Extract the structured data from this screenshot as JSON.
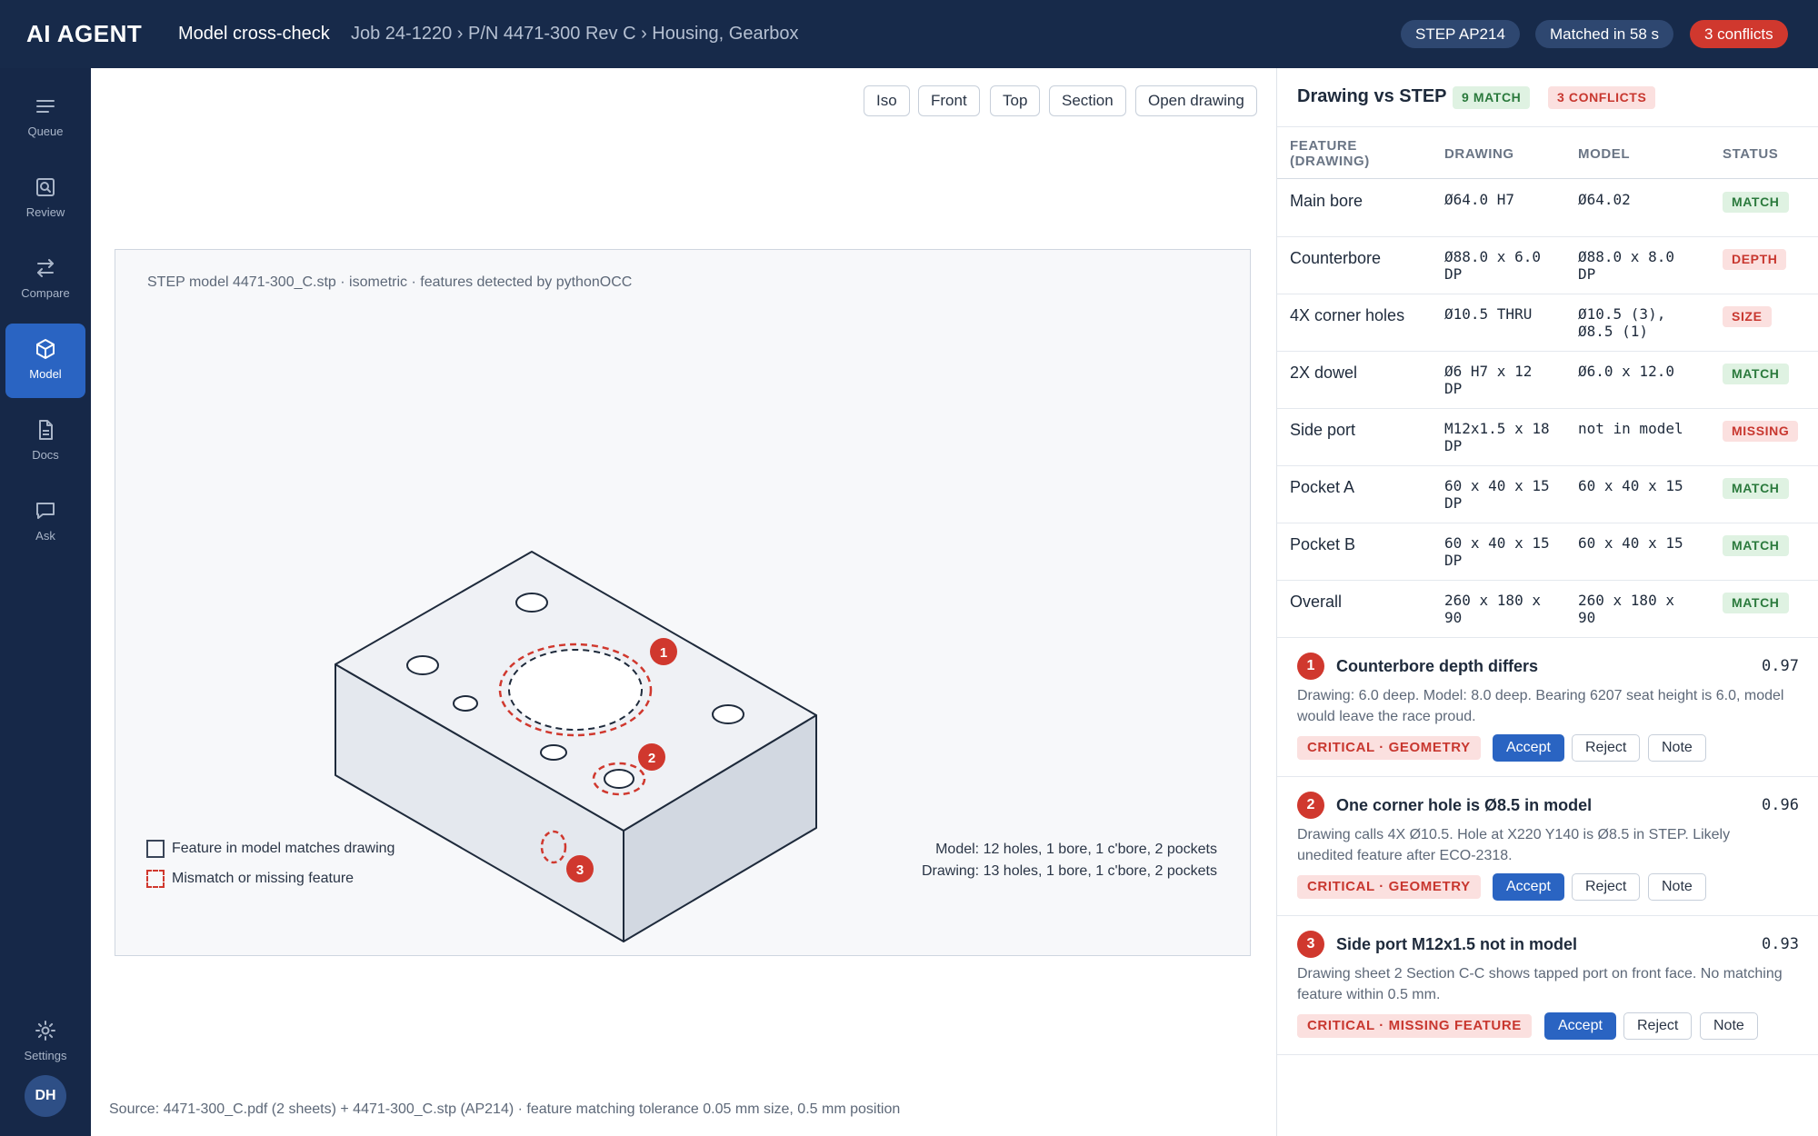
{
  "app": {
    "brand": "AI AGENT",
    "screen_title": "Model cross-check",
    "breadcrumb": "Job 24-1220 › P/N 4471-300 Rev C › Housing, Gearbox",
    "pills": {
      "format": "STEP AP214",
      "matched": "Matched in 58 s",
      "conflicts": "3 conflicts"
    }
  },
  "nav": {
    "items": [
      {
        "label": "Queue",
        "icon": "list-icon"
      },
      {
        "label": "Review",
        "icon": "search-doc-icon"
      },
      {
        "label": "Compare",
        "icon": "compare-arrows-icon"
      },
      {
        "label": "Model",
        "icon": "cube-icon",
        "active": true
      },
      {
        "label": "Docs",
        "icon": "document-icon"
      },
      {
        "label": "Ask",
        "icon": "chat-icon"
      }
    ],
    "settings": "Settings",
    "avatar": "DH"
  },
  "viewer": {
    "buttons": [
      "Iso",
      "Front",
      "Top",
      "Section",
      "Open drawing"
    ],
    "caption": "STEP model 4471-300_C.stp · isometric · features detected by pythonOCC",
    "legend": {
      "match": "Feature in model matches drawing",
      "mismatch": "Mismatch or missing feature"
    },
    "counts": {
      "model": "Model: 12 holes, 1 bore, 1 c'bore, 2 pockets",
      "drawing": "Drawing: 13 holes, 1 bore, 1 c'bore, 2 pockets"
    },
    "markers": [
      "1",
      "2",
      "3"
    ],
    "source": "Source: 4471-300_C.pdf (2 sheets) + 4471-300_C.stp (AP214) · feature matching tolerance 0.05 mm size, 0.5 mm position"
  },
  "panel": {
    "title": "Drawing vs STEP",
    "match_badge": "9 MATCH",
    "conflict_badge": "3 CONFLICTS",
    "columns": {
      "feature": "FEATURE (DRAWING)",
      "drawing": "DRAWING",
      "model": "MODEL",
      "status": "STATUS"
    },
    "rows": [
      {
        "feature": "Main bore",
        "drawing": "Ø64.0 H7",
        "model": "Ø64.02",
        "status": "MATCH",
        "ok": true
      },
      {
        "feature": "Counterbore",
        "drawing": "Ø88.0 x 6.0 DP",
        "model": "Ø88.0 x 8.0 DP",
        "status": "DEPTH",
        "ok": false
      },
      {
        "feature": "4X corner holes",
        "drawing": "Ø10.5 THRU",
        "model": "Ø10.5 (3), Ø8.5 (1)",
        "status": "SIZE",
        "ok": false
      },
      {
        "feature": "2X dowel",
        "drawing": "Ø6 H7 x 12 DP",
        "model": "Ø6.0 x 12.0",
        "status": "MATCH",
        "ok": true
      },
      {
        "feature": "Side port",
        "drawing": "M12x1.5 x 18 DP",
        "model": "not in model",
        "status": "MISSING",
        "ok": false
      },
      {
        "feature": "Pocket A",
        "drawing": "60 x 40 x 15 DP",
        "model": "60 x 40 x 15",
        "status": "MATCH",
        "ok": true
      },
      {
        "feature": "Pocket B",
        "drawing": "60 x 40 x 15 DP",
        "model": "60 x 40 x 15",
        "status": "MATCH",
        "ok": true
      },
      {
        "feature": "Overall",
        "drawing": "260 x 180 x 90",
        "model": "260 x 180 x 90",
        "status": "MATCH",
        "ok": true
      }
    ],
    "issues": [
      {
        "num": "1",
        "title": "Counterbore depth differs",
        "score": "0.97",
        "body": "Drawing: 6.0 deep. Model: 8.0 deep. Bearing 6207 seat height is 6.0, model would leave the race proud.",
        "tag": "CRITICAL · GEOMETRY"
      },
      {
        "num": "2",
        "title": "One corner hole is Ø8.5 in model",
        "score": "0.96",
        "body": "Drawing calls 4X Ø10.5. Hole at X220 Y140 is Ø8.5 in STEP. Likely unedited feature after ECO-2318.",
        "tag": "CRITICAL · GEOMETRY"
      },
      {
        "num": "3",
        "title": "Side port M12x1.5 not in model",
        "score": "0.93",
        "body": "Drawing sheet 2 Section C-C shows tapped port on front face. No matching feature within 0.5 mm.",
        "tag": "CRITICAL · MISSING FEATURE"
      }
    ],
    "actions": {
      "accept": "Accept",
      "reject": "Reject",
      "note": "Note"
    }
  },
  "colors": {
    "navy": "#172a4a",
    "accent": "#2a64c2",
    "danger": "#d0382e",
    "ok": "#2b7a3d"
  }
}
